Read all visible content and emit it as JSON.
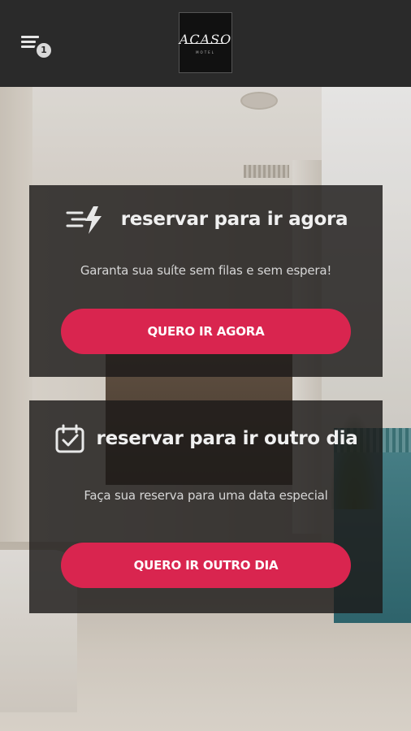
{
  "header": {
    "menu_label": "menu",
    "notification_count": "1",
    "logo_text": "ACASO",
    "logo_subtext": "MOTEL"
  },
  "cards": [
    {
      "icon": "fast-lightning-icon",
      "title": "reservar para ir agora",
      "description": "Garanta sua suíte sem filas e sem espera!",
      "button_label": "QUERO IR AGORA"
    },
    {
      "icon": "calendar-check-icon",
      "title": "reservar para ir outro dia",
      "description": "Faça sua reserva para uma data especial",
      "button_label": "QUERO IR OUTRO DIA"
    }
  ],
  "colors": {
    "topbar": "#2a2a2a",
    "card_bg": "rgba(28,26,24,0.82)",
    "accent": "#d9254f"
  }
}
